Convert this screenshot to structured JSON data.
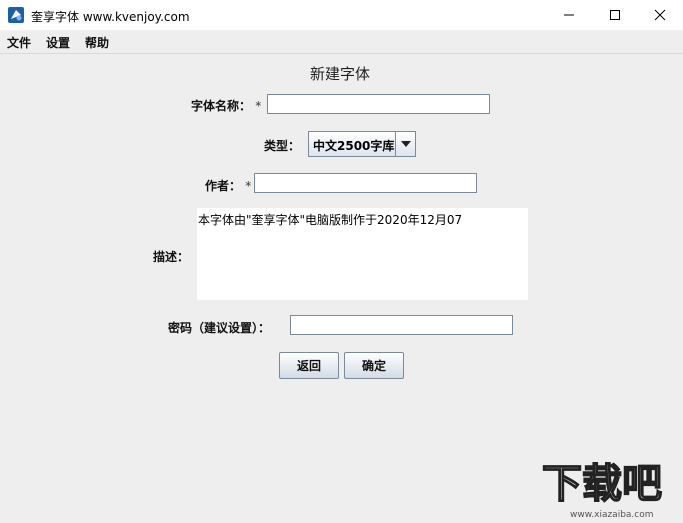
{
  "window": {
    "title": "奎享字体 www.kvenjoy.com"
  },
  "menu": {
    "items": [
      "文件",
      "设置",
      "帮助"
    ]
  },
  "form": {
    "title": "新建字体",
    "font_name_label": "字体名称：",
    "font_name_value": "",
    "required_mark": "*",
    "type_label": "类型：",
    "type_value": "中文2500字库",
    "author_label": "作者：",
    "author_value": "",
    "description_label": "描述：",
    "description_value": "本字体由\"奎享字体\"电脑版制作于2020年12月07",
    "password_label": "密码（建议设置）：",
    "password_value": "",
    "back_button": "返回",
    "ok_button": "确定"
  },
  "watermark": {
    "brand": "下载吧",
    "url": "www.xiazaiba.com"
  },
  "colors": {
    "background": "#eeeeee",
    "titlebar": "#ffffff",
    "field_border": "#7a8a99"
  }
}
